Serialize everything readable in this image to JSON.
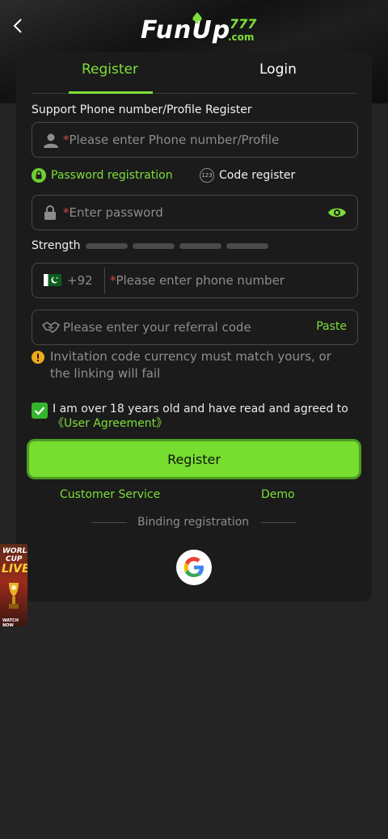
{
  "header": {
    "logo_main": "FunUp",
    "logo_num": "777",
    "logo_com": ".com"
  },
  "tabs": {
    "register": "Register",
    "login": "Login"
  },
  "form": {
    "support_label": "Support Phone number/Profile Register",
    "phone_profile_placeholder": "Please enter Phone number/Profile",
    "required_mark": "*",
    "password_registration": "Password registration",
    "code_register": "Code register",
    "code_icon_text": "123",
    "password_placeholder": "Enter password",
    "strength_label": "Strength",
    "country_code": "+92",
    "phone_placeholder": "Please enter phone number",
    "referral_placeholder": "Please enter your referral code",
    "paste_label": "Paste",
    "notice": "Invitation code currency must match yours, or the linking will fail",
    "agree_text": "I am over 18 years old and have read and agreed to",
    "agree_link": "《User Agreement》",
    "register_button": "Register"
  },
  "links": {
    "customer_service": "Customer Service",
    "demo": "Demo"
  },
  "binding": {
    "label": "Binding registration"
  },
  "promo": {
    "line1": "WORLD",
    "line2": "CUP",
    "line3": "LIVE",
    "line4": "WATCH NOW"
  },
  "colors": {
    "accent": "#7ddf3a",
    "button": "#77dd2e",
    "background": "#242424",
    "card": "#1b1b1b",
    "required": "#d94848"
  },
  "icons": [
    "back-icon",
    "user-icon",
    "lock-icon",
    "code-123-icon",
    "eye-icon",
    "pakistan-flag-icon",
    "handshake-icon",
    "warning-icon",
    "check-icon",
    "google-icon"
  ]
}
